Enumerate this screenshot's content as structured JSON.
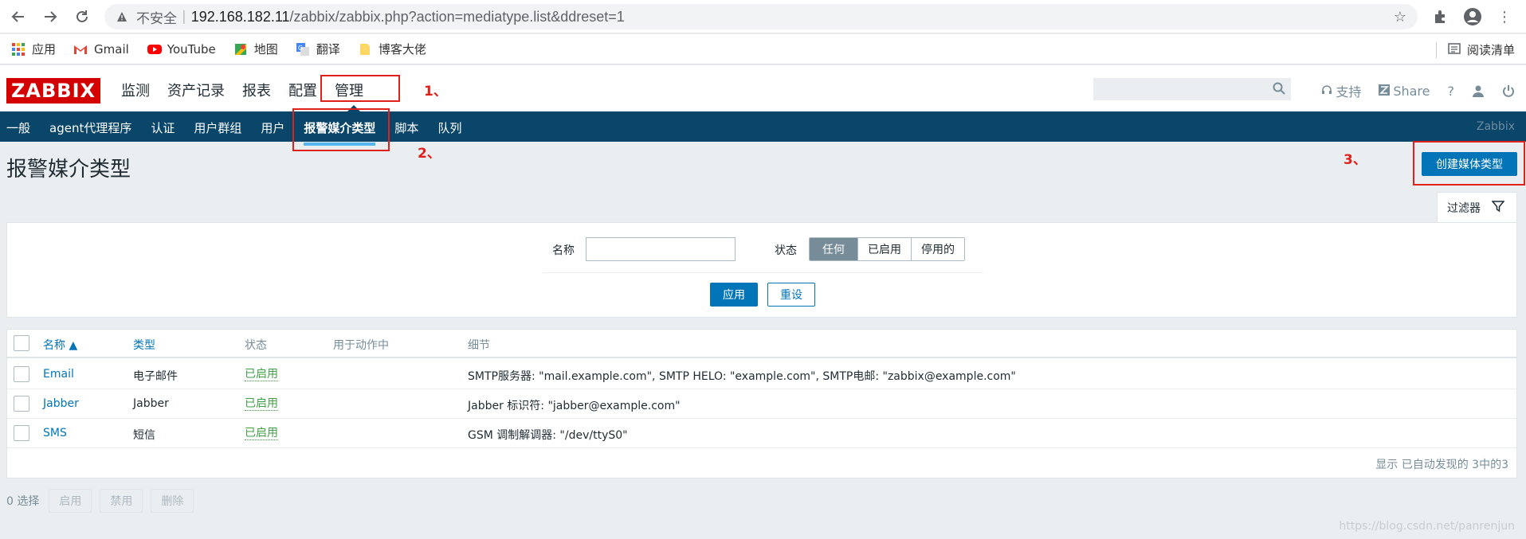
{
  "browser": {
    "insecure_label": "不安全",
    "url_host": "192.168.182.11",
    "url_path": "/zabbix/zabbix.php?action=mediatype.list&ddreset=1",
    "bookmarks": [
      {
        "label": "应用",
        "icon": "apps-grid-icon"
      },
      {
        "label": "Gmail",
        "icon": "gmail-icon"
      },
      {
        "label": "YouTube",
        "icon": "youtube-icon"
      },
      {
        "label": "地图",
        "icon": "maps-icon"
      },
      {
        "label": "翻译",
        "icon": "translate-icon"
      },
      {
        "label": "博客大佬",
        "icon": "folder-icon"
      }
    ],
    "reading_list": "阅读清单"
  },
  "header": {
    "logo": "ZABBIX",
    "menu": [
      "监测",
      "资产记录",
      "报表",
      "配置",
      "管理"
    ],
    "support": "支持",
    "share": "Share",
    "help": "?"
  },
  "submenu": {
    "items": [
      "一般",
      "agent代理程序",
      "认证",
      "用户群组",
      "用户",
      "报警媒介类型",
      "脚本",
      "队列"
    ],
    "active": "报警媒介类型",
    "brand": "Zabbix"
  },
  "page": {
    "title": "报警媒介类型",
    "create_button": "创建媒体类型"
  },
  "filter": {
    "tab_label": "过滤器",
    "name_label": "名称",
    "name_value": "",
    "status_label": "状态",
    "status_options": [
      "任何",
      "已启用",
      "停用的"
    ],
    "status_selected": "任何",
    "apply": "应用",
    "reset": "重设"
  },
  "table": {
    "headers": {
      "name": "名称 ▲",
      "type": "类型",
      "status": "状态",
      "used": "用于动作中",
      "details": "细节"
    },
    "rows": [
      {
        "name": "Email",
        "type": "电子邮件",
        "status": "已启用",
        "details": "SMTP服务器: \"mail.example.com\", SMTP HELO: \"example.com\", SMTP电邮: \"zabbix@example.com\""
      },
      {
        "name": "Jabber",
        "type": "Jabber",
        "status": "已启用",
        "details": "Jabber 标识符: \"jabber@example.com\""
      },
      {
        "name": "SMS",
        "type": "短信",
        "status": "已启用",
        "details": "GSM 调制解调器: \"/dev/ttyS0\""
      }
    ],
    "footer": "显示 已自动发现的 3中的3"
  },
  "bottom": {
    "selected": "0 选择",
    "buttons": [
      "启用",
      "禁用",
      "删除"
    ]
  },
  "annotations": [
    "1、",
    "2、",
    "3、"
  ],
  "watermark": "https://blog.csdn.net/panrenjun",
  "colors": {
    "accent": "#0275b8",
    "subnav": "#0a466a",
    "logo": "#d40000",
    "ok": "#429e47",
    "annotation": "#e0201b"
  }
}
